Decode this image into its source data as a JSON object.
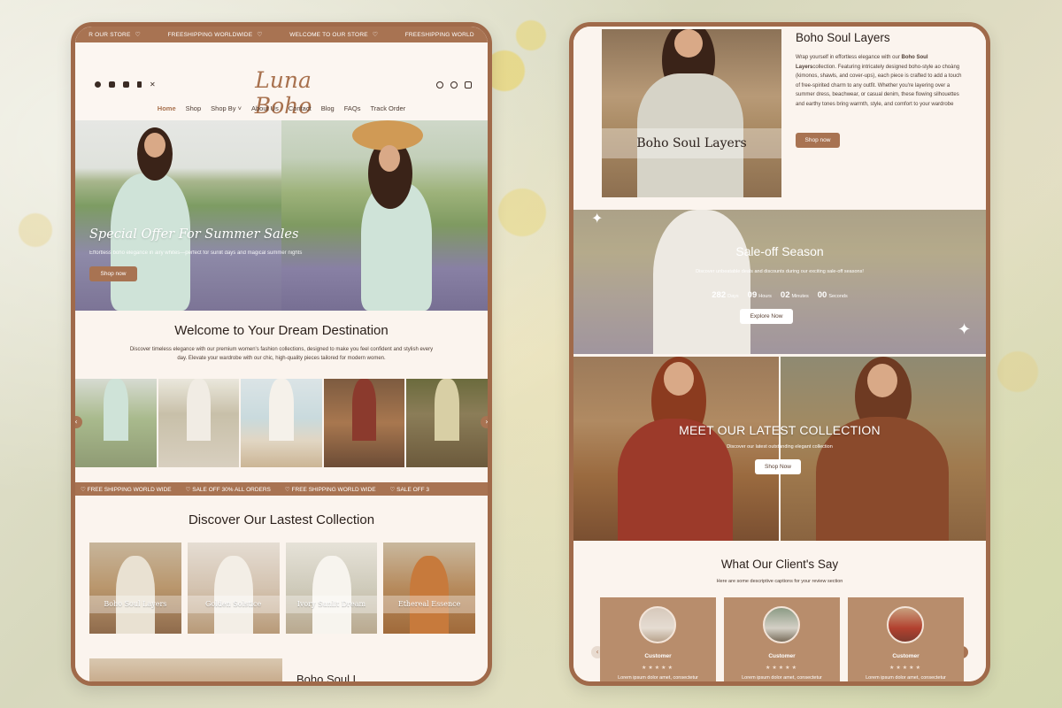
{
  "colors": {
    "accent": "#a87352",
    "frame": "#a06a4a",
    "page_bg": "#fbf4ee",
    "text": "#2c211c"
  },
  "left": {
    "ticker_items": [
      "R OUR STORE",
      "FREESHIPPING WORLDWIDE",
      "WELCOME TO OUR STORE",
      "FREESHIPPING WORLD"
    ],
    "social_icons": [
      "facebook-icon",
      "instagram-icon",
      "youtube-icon",
      "tiktok-icon",
      "x-icon"
    ],
    "logo": "Luna Boho",
    "header_icons": [
      "search-icon",
      "account-icon",
      "cart-icon"
    ],
    "nav": [
      "Home",
      "Shop",
      "Shop By",
      "About Us",
      "Contact",
      "Blog",
      "FAQs",
      "Track Order"
    ],
    "hero": {
      "title": "Special Offer For Summer Sales",
      "subtitle": "Effortless boho elegance in airy whites—perfect for sunlit days and magical summer nights",
      "button": "Shop now"
    },
    "welcome": {
      "title": "Welcome to Your Dream Destination",
      "text": "Discover timeless elegance with our premium women's fashion collections, designed to make you feel confident and stylish every day. Elevate your wardrobe with our chic, high-quality pieces tailored for modern women."
    },
    "ticker2_items": [
      "FREE SHIPPING WORLD WIDE",
      "SALE OFF 30% ALL ORDERS",
      "FREE SHIPPING WORLD WIDE",
      "SALE OFF 3"
    ],
    "collection": {
      "title": "Discover Our Lastest Collection",
      "items": [
        "Boho Soul Layers",
        "Golden Solstice",
        "Ivory Sunlit Dream",
        "Ethereal Essence"
      ]
    },
    "bottom_teaser": "Boho Soul L"
  },
  "right": {
    "feature": {
      "image_label": "Boho Soul Layers",
      "title": "Boho Soul Layers",
      "para_prefix": "Wrap yourself in effortless elegance with our ",
      "para_bold": "Boho Soul Layers",
      "para_rest": "collection. Featuring intricately designed boho-style ao choàng (kimonos, shawls, and cover-ups), each piece is crafted to add a touch of free-spirited charm to any outfit. Whether you're layering over a summer dress, beachwear, or casual denim, these flowing silhouettes and earthy tones bring warmth, style, and comfort to your wardrobe",
      "button": "Shop now"
    },
    "sale": {
      "title": "Sale-off Season",
      "subtitle": "Discover unbeatable deals and discounts during our exciting sale-off seasons!",
      "countdown": [
        {
          "value": "282",
          "unit": "Days"
        },
        {
          "value": "09",
          "unit": "Hours"
        },
        {
          "value": "02",
          "unit": "Minutes"
        },
        {
          "value": "00",
          "unit": "Seconds"
        }
      ],
      "button": "Explore Now"
    },
    "latest": {
      "title": "MEET OUR LATEST COLLECTION",
      "subtitle": "Discover our latest outstanding elegant collection",
      "button": "Shop Now"
    },
    "clients": {
      "title": "What Our Client's Say",
      "subtitle": "Here are some descriptive captions for your review section",
      "reviews": [
        {
          "name": "Customer",
          "stars": "★★★★★",
          "text": "Lorem ipsum dolor amet, consectetur"
        },
        {
          "name": "Customer",
          "stars": "★★★★★",
          "text": "Lorem ipsum dolor amet, consectetur"
        },
        {
          "name": "Customer",
          "stars": "★★★★★",
          "text": "Lorem ipsum dolor amet, consectetur"
        }
      ]
    }
  }
}
